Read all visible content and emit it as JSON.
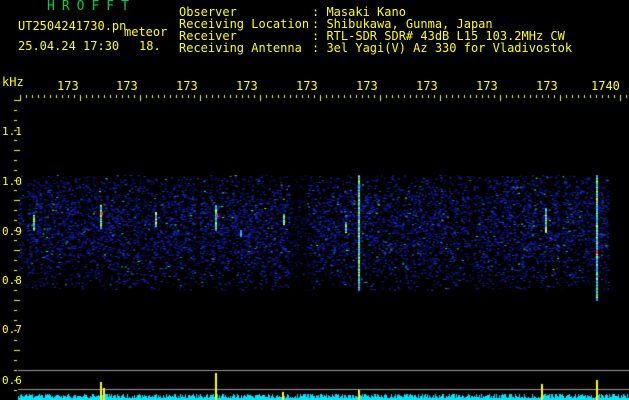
{
  "header": {
    "app_title": "HROFFT",
    "file_name": "UT2504241730.pn",
    "mode_label": "meteor",
    "datetime": "25.04.24 17:30",
    "count": "18.",
    "info": [
      {
        "label": "Observer",
        "value": ": Masaki Kano"
      },
      {
        "label": "Receiving Location",
        "value": ": Shibukawa, Gunma, Japan"
      },
      {
        "label": "Receiver",
        "value": ": RTL-SDR SDR# 43dB L15 103.2MHz CW"
      },
      {
        "label": "Receiving Antenna",
        "value": ": 3el Yagi(V) Az 330 for Vladivostok"
      }
    ]
  },
  "axis": {
    "unit_label": "kHz",
    "x_ticks": [
      "173",
      "173",
      "173",
      "173",
      "173",
      "173",
      "173",
      "173",
      "173",
      "1740"
    ],
    "y_ticks": [
      "1.1",
      "1.0",
      "0.9",
      "0.8",
      "0.7",
      "0.6"
    ]
  },
  "colors": {
    "label_yellow": "#ffff00",
    "title_green": "#00cc44",
    "noise_blue": "#2233ee",
    "baseline_cyan": "#00e5ff",
    "grid_gray": "#9a9a9a"
  }
}
